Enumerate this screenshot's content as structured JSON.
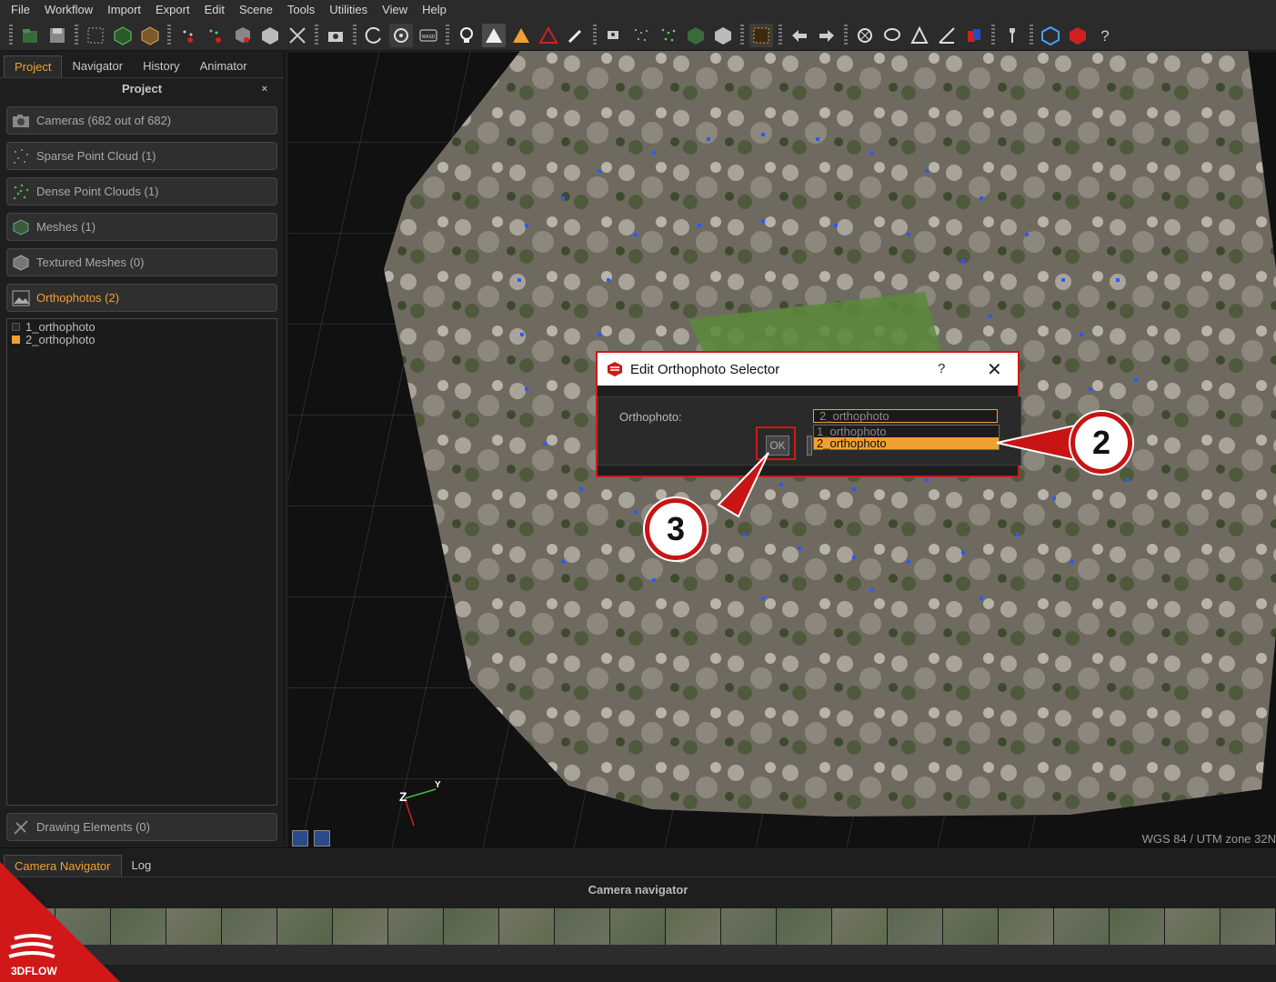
{
  "menubar": [
    "File",
    "Workflow",
    "Import",
    "Export",
    "Edit",
    "Scene",
    "Tools",
    "Utilities",
    "View",
    "Help"
  ],
  "left_panel": {
    "tabs": [
      "Project",
      "Navigator",
      "History",
      "Animator"
    ],
    "active_tab": "Project",
    "title": "Project",
    "close_glyph": "×",
    "categories": [
      {
        "label": "Cameras (682 out of 682)",
        "icon": "camera-icon"
      },
      {
        "label": "Sparse Point Cloud (1)",
        "icon": "sparse-cloud-icon"
      },
      {
        "label": "Dense Point Clouds (1)",
        "icon": "dense-cloud-icon"
      },
      {
        "label": "Meshes (1)",
        "icon": "mesh-icon"
      },
      {
        "label": "Textured Meshes (0)",
        "icon": "textured-mesh-icon"
      },
      {
        "label": "Orthophotos (2)",
        "icon": "orthophoto-icon",
        "active": true
      }
    ],
    "orthophotos": [
      {
        "name": "1_orthophoto",
        "selected": false
      },
      {
        "name": "2_orthophoto",
        "selected": true
      }
    ],
    "drawing_elements": "Drawing Elements (0)"
  },
  "viewport": {
    "crs": "WGS 84 / UTM zone 32N",
    "axis_labels": {
      "z": "Z",
      "y": "Y"
    }
  },
  "dialog": {
    "title": "Edit Orthophoto Selector",
    "help": "?",
    "close": "✕",
    "label": "Orthophoto:",
    "combo_value": "2_orthophoto",
    "options": [
      "1_orthophoto",
      "2_orthophoto"
    ],
    "selected_index": 1,
    "ok_label": "OK"
  },
  "bottom_panel": {
    "tabs": [
      "Camera Navigator",
      "Log"
    ],
    "active_tab": "Camera Navigator",
    "title": "Camera navigator"
  },
  "callouts": [
    "2",
    "3"
  ],
  "logo_text": "3DFLOW",
  "colors": {
    "accent": "#f0a030",
    "callout_red": "#c81414",
    "dialog_border": "#d01818"
  }
}
